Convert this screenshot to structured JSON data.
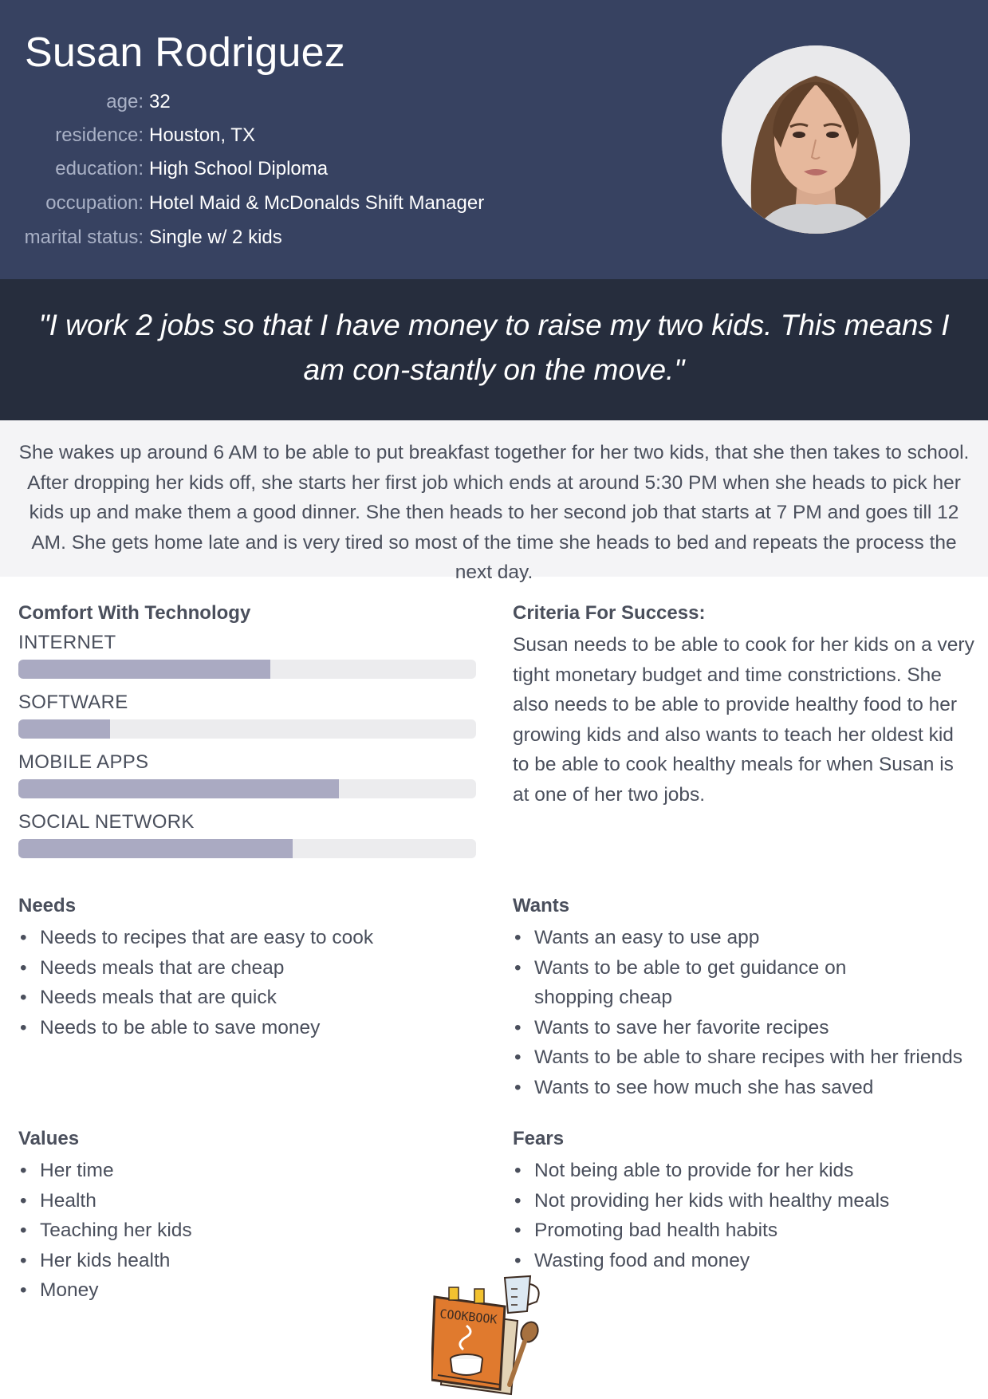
{
  "profile": {
    "name": "Susan Rodriguez",
    "facts": [
      {
        "label": "age:",
        "value": "32"
      },
      {
        "label": "residence:",
        "value": "Houston, TX"
      },
      {
        "label": "education:",
        "value": "High School Diploma"
      },
      {
        "label": "occupation:",
        "value": "Hotel Maid & McDonalds Shift Manager"
      },
      {
        "label": "marital status:",
        "value": "Single w/ 2 kids"
      }
    ]
  },
  "quote": "\"I work 2 jobs so that I have money to raise my two kids. This means I am con-stantly on the move.\"",
  "summary": "She wakes up around 6 AM to be able to put breakfast together for her two kids, that she then takes to school. After dropping her kids off, she starts her first job which ends at around 5:30 PM when she heads to pick her kids up and make them a good dinner. She then heads to her second job that starts at 7 PM and goes till 12 AM. She gets home late and is very tired so most of the time she heads to bed and repeats the process the next day.",
  "technology": {
    "title": "Comfort With Technology",
    "items": [
      {
        "label": "INTERNET",
        "level": 0.55
      },
      {
        "label": "SOFTWARE",
        "level": 0.2
      },
      {
        "label": "MOBILE APPS",
        "level": 0.7
      },
      {
        "label": "SOCIAL NETWORK",
        "level": 0.6
      }
    ]
  },
  "criteria": {
    "title": "Criteria For Success:",
    "text": "Susan needs to be able to cook for her kids on a very tight monetary budget and time constrictions. She also needs to be able to provide healthy food to her growing kids and also wants to teach her oldest kid to be able to cook healthy meals for when Susan is at one of her two jobs."
  },
  "needs": {
    "title": "Needs",
    "items": [
      "Needs to recipes that are easy to cook",
      "Needs meals that are cheap",
      "Needs meals that are quick",
      "Needs to be able to save money"
    ]
  },
  "wants": {
    "title": "Wants",
    "items": [
      "Wants an easy to use app",
      "Wants to be able to get guidance on shopping cheap",
      "Wants to save her favorite recipes",
      "Wants to be able to share recipes with her friends",
      "Wants to see how much she has saved"
    ]
  },
  "values": {
    "title": "Values",
    "items": [
      "Her time",
      "Health",
      "Teaching her kids",
      "Her kids health",
      "Money"
    ]
  },
  "fears": {
    "title": "Fears",
    "items": [
      "Not being able to provide for her kids",
      "Not providing her kids with healthy meals",
      "Promoting bad health habits",
      "Wasting food and money"
    ]
  },
  "logo": {
    "text": "COOKBOOK"
  },
  "colors": {
    "header": "#374261",
    "quote_band": "#262d3d",
    "bar_fill": "#aaaac2",
    "bar_track": "#ececee"
  }
}
